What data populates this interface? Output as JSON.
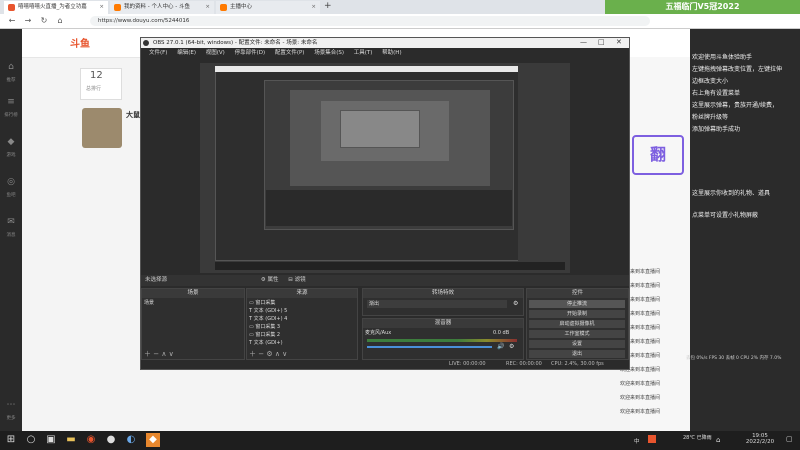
{
  "browser": {
    "tabs": [
      {
        "label": "嘻嘻嘻嘻火直播_为者立功嘉",
        "active": true,
        "color": "#e8552e"
      },
      {
        "label": "我的资料 - 个人中心 - 斗鱼",
        "active": false,
        "color": "#ff7a00"
      },
      {
        "label": "主播中心",
        "active": false,
        "color": "#ff7a00"
      }
    ],
    "new_tab": "+",
    "url": "https://www.douyu.com/5244016",
    "top_banner": "五福临门V5冠2022"
  },
  "site": {
    "logo": "斗鱼",
    "left_nav": [
      "推荐",
      "排行榜",
      "游戏",
      "鱼吧",
      "消息",
      "更多"
    ],
    "room_number": "12",
    "room_sublabel": "总排行",
    "streamer": "大鼠"
  },
  "right_panel": {
    "lines": [
      "欢迎使用斗鱼体验助手",
      "左键拖拽弹幕改变位置，左键拉伸",
      "边框改变大小",
      "右上角有设置菜单",
      "这里展示弹幕，贵族开通/续费，",
      "粉丝牌升级等",
      "添加弹幕助手成功",
      "这里展示你收到的礼物、道具",
      "点菜单可设置小礼物屏蔽"
    ],
    "stats": "丢包 0%/s FPS 30 丢帧 0 CPU 2% 内存 7.0%"
  },
  "chat": {
    "rows": [
      "欢迎来到本直播间",
      "欢迎来到本直播间",
      "欢迎来到本直播间",
      "欢迎来到本直播间",
      "欢迎来到本直播间",
      "欢迎来到本直播间",
      "欢迎来到本直播间",
      "欢迎来到本直播间",
      "欢迎来到本直播间",
      "欢迎来到本直播间",
      "欢迎来到本直播间"
    ]
  },
  "obs": {
    "title": "OBS 27.0.1 (64-bit, windows) - 配置文件: 未命名 - 场景: 未命名",
    "menu": [
      "文件(F)",
      "编辑(E)",
      "视图(V)",
      "停靠部件(D)",
      "配置文件(P)",
      "场景集合(S)",
      "工具(T)",
      "帮助(H)"
    ],
    "source_bar": "未选择源",
    "source_bar_props": "属性",
    "source_bar_filters": "滤镜",
    "scenes": {
      "header": "场景",
      "items": [
        "场景"
      ]
    },
    "sources": {
      "header": "来源",
      "items": [
        "窗口采集",
        "文本 (GDI+) 5",
        "文本 (GDI+) 4",
        "窗口采集 3",
        "窗口采集 2",
        "文本 (GDI+)"
      ]
    },
    "transitions": {
      "header": "转场特效",
      "selected": "渐出",
      "duration_label": "时长",
      "duration": "300 ms"
    },
    "mixer": {
      "header": "混音器",
      "channel": "麦克风/Aux",
      "level": "0.0 dB"
    },
    "controls": {
      "header": "控件",
      "buttons": [
        "停止推流",
        "开始录制",
        "启动虚拟摄像机",
        "工作室模式",
        "设置",
        "退出"
      ]
    },
    "status": {
      "live": "LIVE: 00:00:00",
      "rec": "REC: 00:00:00",
      "cpu": "CPU: 2.4%, 30.00 fps"
    }
  },
  "taskbar": {
    "weather": "28℃ 已降雨",
    "time": "19:05",
    "date": "2022/2/20",
    "lang": "中"
  }
}
